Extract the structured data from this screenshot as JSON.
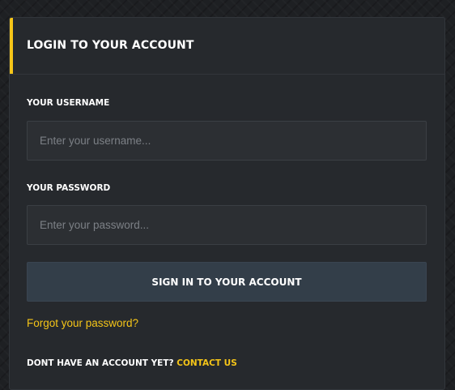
{
  "login": {
    "title": "LOGIN TO YOUR ACCOUNT",
    "username": {
      "label": "YOUR USERNAME",
      "placeholder": "Enter your username...",
      "value": ""
    },
    "password": {
      "label": "YOUR PASSWORD",
      "placeholder": "Enter your password...",
      "value": ""
    },
    "submit_label": "SIGN IN TO YOUR ACCOUNT",
    "forgot_link": "Forgot your password?",
    "signup_prompt": "DONT HAVE AN ACCOUNT YET?",
    "contact_link": "CONTACT US"
  },
  "colors": {
    "accent": "#f5c518",
    "panel": "#26292d",
    "input": "#2c2f33",
    "button": "#333e49"
  }
}
